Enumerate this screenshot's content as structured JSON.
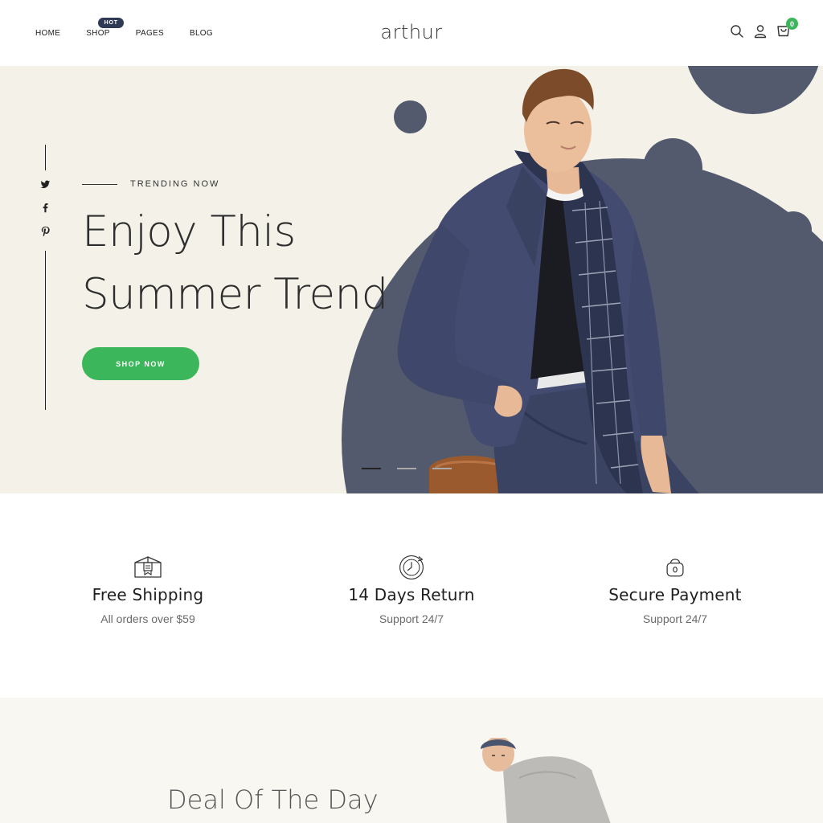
{
  "header": {
    "nav": [
      "HOME",
      "SHOP",
      "PAGES",
      "BLOG"
    ],
    "hot_badge": "HOT",
    "logo": "arthur",
    "icons": [
      "search-icon",
      "user-icon",
      "cart-icon"
    ],
    "cart_count": "0"
  },
  "hero": {
    "social": [
      "twitter-icon",
      "facebook-icon",
      "pinterest-icon"
    ],
    "eyebrow": "TRENDING NOW",
    "title_line1": "Enjoy This",
    "title_line2": "Summer Trend",
    "cta": "SHOP NOW",
    "slides": 3,
    "active_slide": 1
  },
  "features": [
    {
      "icon": "box-icon",
      "title": "Free Shipping",
      "subtitle": "All orders over $59"
    },
    {
      "icon": "return-clock-icon",
      "title": "14 Days Return",
      "subtitle": "Support 24/7"
    },
    {
      "icon": "lock-icon",
      "title": "Secure Payment",
      "subtitle": "Support 24/7"
    }
  ],
  "deal": {
    "title": "Deal Of The Day"
  },
  "colors": {
    "accent": "#3cb65a",
    "hero_bg": "#f3f1e8",
    "blob": "#545a6e",
    "badge": "#2f3b55"
  }
}
